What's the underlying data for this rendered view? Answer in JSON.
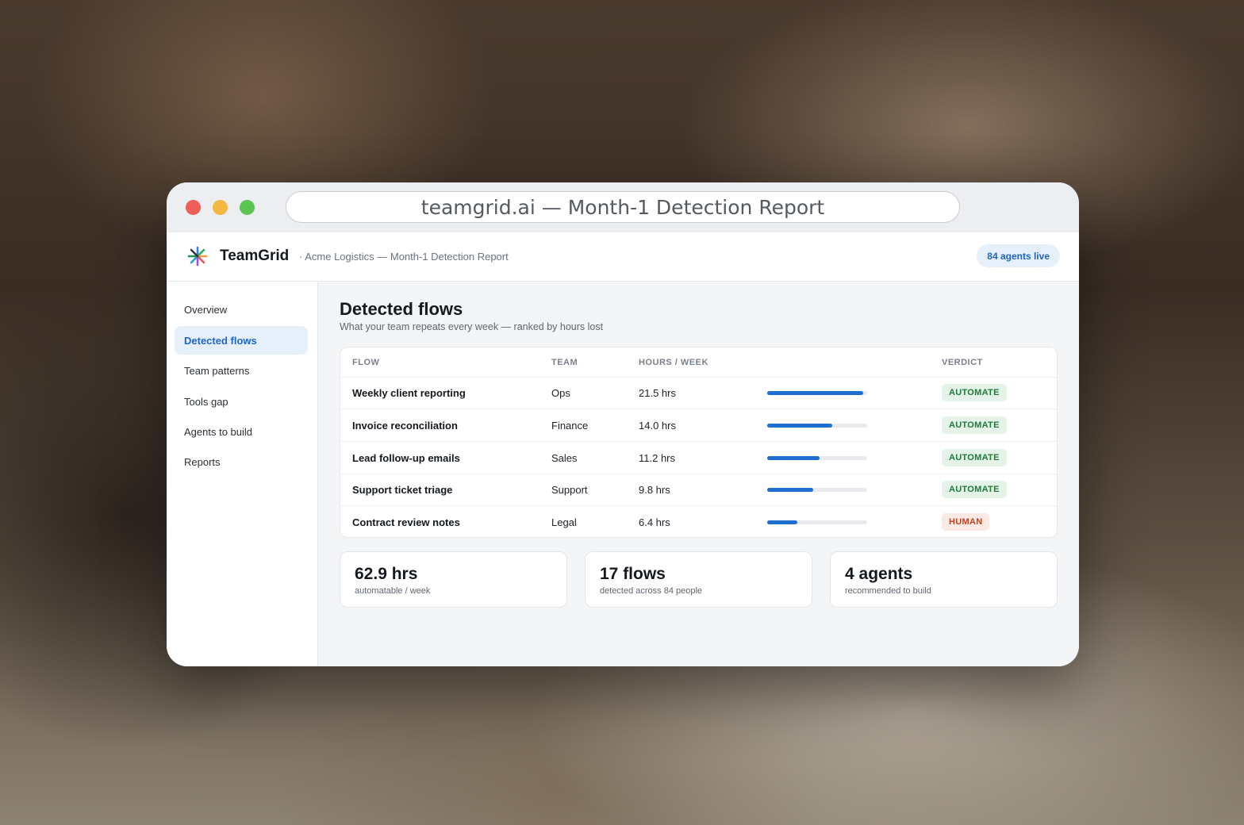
{
  "browser": {
    "url_title": "teamgrid.ai — Month-1 Detection Report"
  },
  "header": {
    "brand": "TeamGrid",
    "subtitle": "· Acme Logistics — Month-1 Detection Report",
    "agents_badge": "84 agents live"
  },
  "sidebar": {
    "items": [
      {
        "label": "Overview",
        "active": false
      },
      {
        "label": "Detected flows",
        "active": true
      },
      {
        "label": "Team patterns",
        "active": false
      },
      {
        "label": "Tools gap",
        "active": false
      },
      {
        "label": "Agents to build",
        "active": false
      },
      {
        "label": "Reports",
        "active": false
      }
    ]
  },
  "main": {
    "title": "Detected flows",
    "subtitle": "What your team repeats every week — ranked by hours lost",
    "table": {
      "columns": {
        "flow": "FLOW",
        "team": "TEAM",
        "hours": "HOURS / WEEK",
        "verdict": "VERDICT"
      },
      "rows": [
        {
          "flow": "Weekly client reporting",
          "team": "Ops",
          "hours": "21.5 hrs",
          "level": 0.96,
          "verdict": "AUTOMATE"
        },
        {
          "flow": "Invoice reconciliation",
          "team": "Finance",
          "hours": "14.0 hrs",
          "level": 0.65,
          "verdict": "AUTOMATE"
        },
        {
          "flow": "Lead follow-up emails",
          "team": "Sales",
          "hours": "11.2 hrs",
          "level": 0.52,
          "verdict": "AUTOMATE"
        },
        {
          "flow": "Support ticket triage",
          "team": "Support",
          "hours": "9.8 hrs",
          "level": 0.46,
          "verdict": "AUTOMATE"
        },
        {
          "flow": "Contract review notes",
          "team": "Legal",
          "hours": "6.4 hrs",
          "level": 0.3,
          "verdict": "HUMAN"
        }
      ]
    },
    "stats": [
      {
        "value": "62.9 hrs",
        "label": "automatable / week"
      },
      {
        "value": "17 flows",
        "label": "detected across 84 people"
      },
      {
        "value": "4 agents",
        "label": "recommended to build"
      }
    ]
  },
  "colors": {
    "accent": "#1f6fd1",
    "automate_text": "#1f7a3a",
    "automate_bg": "#e4f4e8",
    "human_text": "#c2411c",
    "human_bg": "#fbe9e4"
  }
}
